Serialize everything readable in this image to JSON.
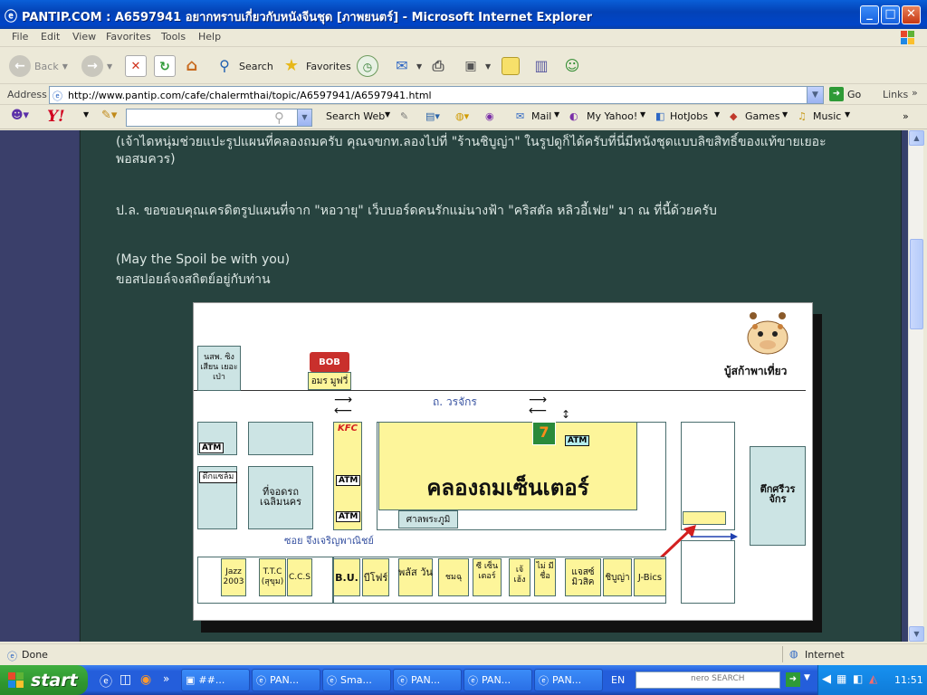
{
  "window": {
    "title": "PANTIP.COM : A6597941 อยากทราบเกี่ยวกับหนังจีนชุด [ภาพยนตร์] - Microsoft Internet Explorer",
    "controls": {
      "minimize": "_",
      "maximize": "□",
      "close": "✕"
    }
  },
  "menu": [
    "File",
    "Edit",
    "View",
    "Favorites",
    "Tools",
    "Help"
  ],
  "toolbar": {
    "back": "Back",
    "search": "Search",
    "favorites": "Favorites"
  },
  "address": {
    "label": "Address",
    "url": "http://www.pantip.com/cafe/chalermthai/topic/A6597941/A6597941.html",
    "go": "Go",
    "links": "Links"
  },
  "yahoo": {
    "logo": "Y!",
    "search_web": "Search Web",
    "mail": "Mail",
    "my_yahoo": "My Yahoo!",
    "hotjobs": "HotJobs",
    "games": "Games",
    "music": "Music"
  },
  "content": {
    "p1_line1": "(เจ้าไดหนุ่มช่วยแปะรูปแผนที่คลองถมครับ  คุณจขกท.ลองไปที่ \"ร้านชิบูญ่า\" ในรูปดูก็ได้ครับที่นี่มีหนังชุดแบบลิขสิทธิ์ของแท้ขายเยอะ",
    "p1_line2": "พอสมควร)",
    "p2": "ป.ล. ขอขอบคุณเครดิตรูปแผนที่จาก \"หอวายุ\"  เว็บบอร์ดคนรักแม่นางฟ้า \"คริสตัล หลิวอี้เฟย\" มา ณ ที่นี้ด้วยครับ",
    "p3_line1": "(May the Spoil be with you)",
    "p3_line2": "ขอสปอยล์จงสถิตย์อยู่กับท่าน"
  },
  "map": {
    "credit": "บู้สก้าพาเที่ยว",
    "road": "ถ. วรจักร",
    "soi": "ซอย จึงเจริญพาณิชย์",
    "center": "คลองถมเซ็นเตอร์",
    "shrine": "ศาลพระภูมิ",
    "bank": "นสพ. ซิงเสียน เยอะเป่า",
    "bob": "BOB",
    "amorn": "อมร มูฟวี่",
    "kfc": "KFC",
    "atm": "ATM",
    "seven": "7",
    "tuk": "ตึกแซล์ม",
    "parking": "ที่จอดรถ เฉลิมนคร",
    "tower": "ตึกศรีวร จักร",
    "shops": [
      "Jazz 2003",
      "T.T.C (สุขุม)",
      "C.C.S",
      "B.U.",
      "บีโฟร์",
      "พลัส วัน",
      "ชมฉุ",
      "ซี เซ็น เตอร์",
      "เจ้ เฮ้ง",
      "ไม่ มี ชื่อ",
      "แจสซ์ มิวสิค",
      "ชิบูญ่า",
      "J-Bics"
    ]
  },
  "status": {
    "text": "Done",
    "zone": "Internet"
  },
  "taskbar": {
    "start": "start",
    "tasks": [
      "##...",
      "PAN...",
      "Sma...",
      "PAN...",
      "PAN...",
      "PAN..."
    ],
    "lang": "EN",
    "search_brand": "nero SEARCH",
    "time": "11:51"
  }
}
